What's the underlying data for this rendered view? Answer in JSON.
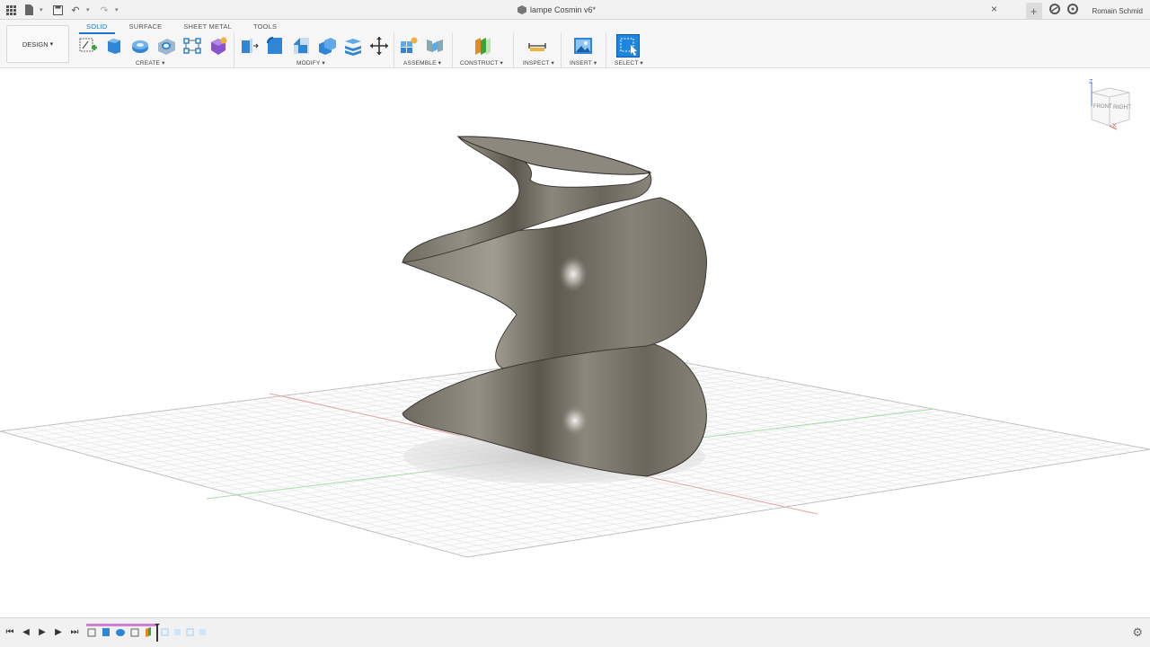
{
  "window": {
    "document_title": "lampe Cosmin v6*",
    "user_name": "Romain Schmid"
  },
  "workspace": {
    "mode_label": "DESIGN"
  },
  "tabs": [
    {
      "label": "SOLID",
      "active": true
    },
    {
      "label": "SURFACE",
      "active": false
    },
    {
      "label": "SHEET METAL",
      "active": false
    },
    {
      "label": "TOOLS",
      "active": false
    }
  ],
  "groups": {
    "create": "CREATE",
    "modify": "MODIFY",
    "assemble": "ASSEMBLE",
    "construct": "CONSTRUCT",
    "inspect": "INSPECT",
    "insert": "INSERT",
    "select": "SELECT"
  },
  "viewcube": {
    "front_label": "FRONT",
    "right_label": "RIGHT",
    "z_label": "Z",
    "x_label": "X"
  },
  "colors": {
    "accent": "#1a73c9",
    "model_surface": "#7b766b",
    "timeline_marker": "#d07fd6"
  }
}
